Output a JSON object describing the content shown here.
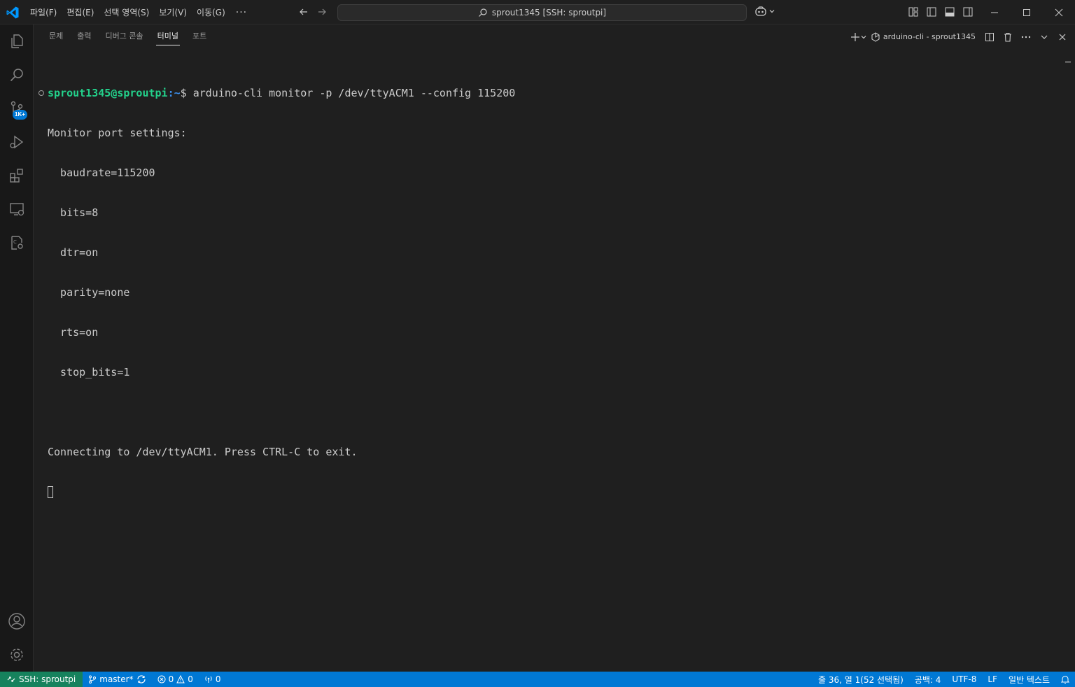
{
  "titlebar": {
    "menu": [
      "파일(F)",
      "편집(E)",
      "선택 영역(S)",
      "보기(V)",
      "이동(G)"
    ],
    "menu_more": "···",
    "command_center": "sprout1345 [SSH: sproutpi]"
  },
  "activitybar": {
    "source_control_badge": "1K+"
  },
  "panel": {
    "tabs": [
      "문제",
      "출력",
      "디버그 콘솔",
      "터미널",
      "포트"
    ],
    "active_tab": "터미널",
    "terminal_name": "arduino-cli - sprout1345"
  },
  "terminal": {
    "prompt_user": "sprout1345@sproutpi",
    "prompt_path": ":~",
    "prompt_command": "$ arduino-cli monitor -p /dev/ttyACM1 --config 115200",
    "lines": [
      "Monitor port settings:",
      "  baudrate=115200",
      "  bits=8",
      "  dtr=on",
      "  parity=none",
      "  rts=on",
      "  stop_bits=1",
      "",
      "Connecting to /dev/ttyACM1. Press CTRL-C to exit."
    ]
  },
  "statusbar": {
    "remote": "SSH: sproutpi",
    "branch": "master*",
    "errors": "0",
    "warnings": "0",
    "ports": "0",
    "position": "줄 36, 열 1(52 선택됨)",
    "spaces": "공백: 4",
    "encoding": "UTF-8",
    "eol": "LF",
    "language": "일반 텍스트"
  },
  "colors": {
    "statusbar_bg": "#0078d4",
    "remote_bg": "#16825d",
    "prompt_user": "#23d18b",
    "prompt_path": "#3b8eea",
    "background": "#1f1f1f"
  }
}
